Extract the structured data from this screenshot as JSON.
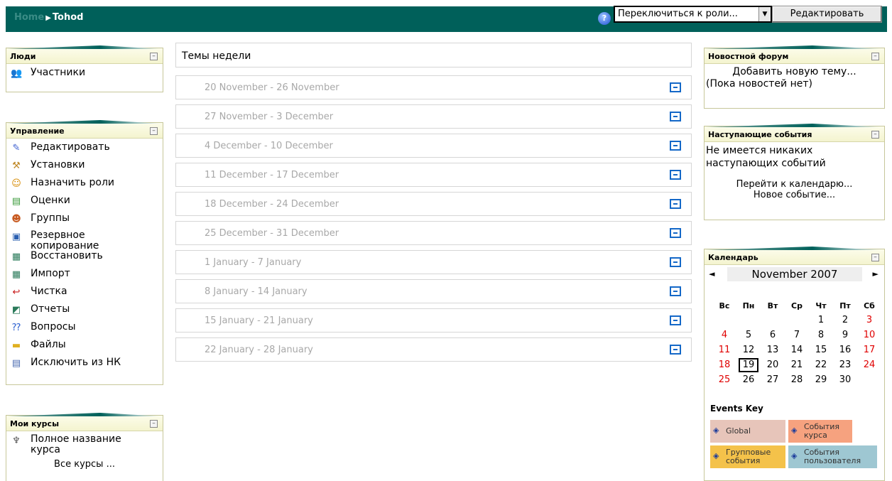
{
  "nav": {
    "breadcrumb_home": "Home",
    "breadcrumb_sep": "▶",
    "breadcrumb_current": "Tohod",
    "role_select_value": "Переключиться к роли...",
    "edit_button": "Редактировать"
  },
  "people_block": {
    "title": "Люди",
    "items": [
      {
        "label": "Участники",
        "icon": "users-icon"
      }
    ]
  },
  "admin_block": {
    "title": "Управление",
    "items": [
      {
        "label": "Редактировать",
        "icon": "edit-icon"
      },
      {
        "label": "Установки",
        "icon": "settings-icon"
      },
      {
        "label": "Назначить роли",
        "icon": "roles-icon"
      },
      {
        "label": "Оценки",
        "icon": "grades-icon"
      },
      {
        "label": "Группы",
        "icon": "groups-icon"
      },
      {
        "label": "Резервное копирование",
        "icon": "backup-icon"
      },
      {
        "label": "Восстановить",
        "icon": "restore-icon"
      },
      {
        "label": "Импорт",
        "icon": "import-icon"
      },
      {
        "label": "Чистка",
        "icon": "reset-icon"
      },
      {
        "label": "Отчеты",
        "icon": "reports-icon"
      },
      {
        "label": "Вопросы",
        "icon": "questions-icon"
      },
      {
        "label": "Файлы",
        "icon": "folder-icon"
      },
      {
        "label": "Исключить из НК",
        "icon": "unenrol-icon"
      }
    ]
  },
  "mycourses_block": {
    "title": "Мои курсы",
    "course": "Полное название курса",
    "all_courses": "Все курсы ..."
  },
  "main": {
    "title": "Темы недели",
    "weeks": [
      "20 November - 26 November",
      "27 November - 3 December",
      "4 December - 10 December",
      "11 December - 17 December",
      "18 December - 24 December",
      "25 December - 31 December",
      "1 January - 7 January",
      "8 January - 14 January",
      "15 January - 21 January",
      "22 January - 28 January"
    ]
  },
  "news_block": {
    "title": "Новостной форум",
    "add_topic": "Добавить новую тему...",
    "no_news": "(Пока новостей нет)"
  },
  "upcoming_block": {
    "title": "Наступающие события",
    "no_events": "Не имеется никаких наступающих событий",
    "goto_calendar": "Перейти к календарю...",
    "new_event": "Новое событие..."
  },
  "calendar_block": {
    "title": "Календарь",
    "prev": "◄",
    "next": "►",
    "month": "November 2007",
    "weekdays": [
      "Вс",
      "Пн",
      "Вт",
      "Ср",
      "Чт",
      "Пт",
      "Сб"
    ],
    "weeks": [
      [
        "",
        "",
        "",
        "",
        "1",
        "2",
        "3"
      ],
      [
        "4",
        "5",
        "6",
        "7",
        "8",
        "9",
        "10"
      ],
      [
        "11",
        "12",
        "13",
        "14",
        "15",
        "16",
        "17"
      ],
      [
        "18",
        "19",
        "20",
        "21",
        "22",
        "23",
        "24"
      ],
      [
        "25",
        "26",
        "27",
        "28",
        "29",
        "30",
        ""
      ]
    ],
    "today": "19",
    "events_key_title": "Events Key",
    "keys": [
      {
        "label": "Global",
        "color": "#e7c5ba"
      },
      {
        "label": "События курса",
        "color": "#f6a27f"
      },
      {
        "label": "Групповые события",
        "color": "#f4c24a"
      },
      {
        "label": "События пользователя",
        "color": "#9ec7d2"
      }
    ]
  }
}
